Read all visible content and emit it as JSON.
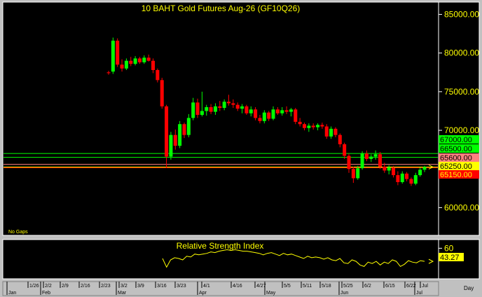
{
  "chart_data": {
    "type": "candlestick",
    "title": "10 BAHT Gold Futures Aug-26 (GF10Q26)",
    "price_axis": {
      "ticks": [
        "85000.00",
        "80000.00",
        "75000.00",
        "70000.00",
        "65000.00",
        "60000.00"
      ],
      "ylim": [
        56500,
        86500
      ]
    },
    "levels": [
      {
        "label": "67000.00",
        "value": 67000,
        "color": "#00ff00",
        "text_color": "#000000"
      },
      {
        "label": "66500.00",
        "value": 66500,
        "color": "#00ff00",
        "text_color": "#000000"
      },
      {
        "label": "65600.00",
        "value": 65600,
        "color": "#ff8080",
        "text_color": "#000000"
      },
      {
        "label": "65250.00",
        "value": 65250,
        "color": "#ffff00",
        "text_color": "#000000"
      },
      {
        "label": "65150.00",
        "value": 65150,
        "color": "#ff0000",
        "text_color": "#ffff00"
      }
    ],
    "date_axis": {
      "month_labels": [
        "Jan",
        "Feb",
        "Mar",
        "Apr",
        "May",
        "Jun",
        "Jul"
      ],
      "day_labels": [
        "1/26",
        "2/2",
        "2/9",
        "2/16",
        "2/23",
        "3/2",
        "3/9",
        "3/16",
        "3/23",
        "4/1",
        "4/16",
        "4/27",
        "5/5",
        "5/11",
        "5/18",
        "5/25",
        "6/2",
        "6/15",
        "6/22",
        "Jul"
      ],
      "unit_label": "Day"
    },
    "notes": "No Gaps",
    "candles": [
      {
        "o": 77500,
        "h": 77700,
        "l": 77200,
        "c": 77400
      },
      {
        "o": 77600,
        "h": 82000,
        "l": 77300,
        "c": 81600
      },
      {
        "o": 81600,
        "h": 81900,
        "l": 78200,
        "c": 78500
      },
      {
        "o": 78500,
        "h": 79200,
        "l": 77600,
        "c": 78000
      },
      {
        "o": 78000,
        "h": 79300,
        "l": 77800,
        "c": 79000
      },
      {
        "o": 79000,
        "h": 79500,
        "l": 78300,
        "c": 78600
      },
      {
        "o": 78600,
        "h": 79600,
        "l": 78400,
        "c": 79300
      },
      {
        "o": 79300,
        "h": 79500,
        "l": 78600,
        "c": 78800
      },
      {
        "o": 78800,
        "h": 79700,
        "l": 78600,
        "c": 79400
      },
      {
        "o": 79400,
        "h": 79800,
        "l": 78900,
        "c": 79000
      },
      {
        "o": 79000,
        "h": 79300,
        "l": 77400,
        "c": 77800
      },
      {
        "o": 77800,
        "h": 78000,
        "l": 76200,
        "c": 76500
      },
      {
        "o": 76500,
        "h": 76800,
        "l": 72800,
        "c": 73100
      },
      {
        "o": 73100,
        "h": 73300,
        "l": 65200,
        "c": 66600
      },
      {
        "o": 66600,
        "h": 69800,
        "l": 66200,
        "c": 69400
      },
      {
        "o": 69400,
        "h": 70100,
        "l": 67500,
        "c": 68000
      },
      {
        "o": 68000,
        "h": 71200,
        "l": 67700,
        "c": 70800
      },
      {
        "o": 70800,
        "h": 71000,
        "l": 69000,
        "c": 69400
      },
      {
        "o": 69400,
        "h": 72100,
        "l": 69100,
        "c": 71600
      },
      {
        "o": 71600,
        "h": 74200,
        "l": 71300,
        "c": 73600
      },
      {
        "o": 73600,
        "h": 74100,
        "l": 71600,
        "c": 72000
      },
      {
        "o": 72000,
        "h": 75000,
        "l": 71800,
        "c": 72500
      },
      {
        "o": 72500,
        "h": 73300,
        "l": 71900,
        "c": 73000
      },
      {
        "o": 73000,
        "h": 73400,
        "l": 72100,
        "c": 72400
      },
      {
        "o": 72400,
        "h": 73500,
        "l": 72000,
        "c": 73100
      },
      {
        "o": 73100,
        "h": 73800,
        "l": 72500,
        "c": 72900
      },
      {
        "o": 72900,
        "h": 74000,
        "l": 72600,
        "c": 73700
      },
      {
        "o": 73700,
        "h": 74600,
        "l": 73200,
        "c": 73500
      },
      {
        "o": 73500,
        "h": 74000,
        "l": 72900,
        "c": 73300
      },
      {
        "o": 73300,
        "h": 73600,
        "l": 72500,
        "c": 72800
      },
      {
        "o": 72800,
        "h": 73400,
        "l": 72200,
        "c": 73100
      },
      {
        "o": 73100,
        "h": 73300,
        "l": 72000,
        "c": 72200
      },
      {
        "o": 72200,
        "h": 73100,
        "l": 71800,
        "c": 72700
      },
      {
        "o": 72700,
        "h": 73000,
        "l": 71300,
        "c": 71600
      },
      {
        "o": 71600,
        "h": 72000,
        "l": 70900,
        "c": 71200
      },
      {
        "o": 71200,
        "h": 72600,
        "l": 70900,
        "c": 72300
      },
      {
        "o": 72300,
        "h": 72500,
        "l": 71200,
        "c": 71500
      },
      {
        "o": 71500,
        "h": 73100,
        "l": 71300,
        "c": 72700
      },
      {
        "o": 72700,
        "h": 73000,
        "l": 72000,
        "c": 72200
      },
      {
        "o": 72200,
        "h": 73000,
        "l": 71900,
        "c": 72600
      },
      {
        "o": 72600,
        "h": 73100,
        "l": 72100,
        "c": 72400
      },
      {
        "o": 72400,
        "h": 72900,
        "l": 71800,
        "c": 72700
      },
      {
        "o": 72700,
        "h": 72900,
        "l": 70800,
        "c": 71100
      },
      {
        "o": 71100,
        "h": 71600,
        "l": 70500,
        "c": 70800
      },
      {
        "o": 70800,
        "h": 71000,
        "l": 70000,
        "c": 70300
      },
      {
        "o": 70300,
        "h": 70900,
        "l": 69800,
        "c": 70600
      },
      {
        "o": 70600,
        "h": 70900,
        "l": 70100,
        "c": 70400
      },
      {
        "o": 70400,
        "h": 70900,
        "l": 70000,
        "c": 70700
      },
      {
        "o": 70700,
        "h": 71000,
        "l": 70200,
        "c": 70500
      },
      {
        "o": 70500,
        "h": 70800,
        "l": 68900,
        "c": 69200
      },
      {
        "o": 69200,
        "h": 70500,
        "l": 68900,
        "c": 70200
      },
      {
        "o": 70200,
        "h": 70400,
        "l": 69100,
        "c": 69400
      },
      {
        "o": 69400,
        "h": 69600,
        "l": 67800,
        "c": 68200
      },
      {
        "o": 68200,
        "h": 68400,
        "l": 66300,
        "c": 66700
      },
      {
        "o": 66700,
        "h": 67000,
        "l": 64500,
        "c": 65000
      },
      {
        "o": 65000,
        "h": 65300,
        "l": 63200,
        "c": 63800
      },
      {
        "o": 63800,
        "h": 65400,
        "l": 63600,
        "c": 65100
      },
      {
        "o": 65100,
        "h": 67300,
        "l": 64900,
        "c": 67000
      },
      {
        "o": 67000,
        "h": 67400,
        "l": 66000,
        "c": 66300
      },
      {
        "o": 66300,
        "h": 66900,
        "l": 65900,
        "c": 66600
      },
      {
        "o": 66600,
        "h": 67400,
        "l": 66200,
        "c": 66900
      },
      {
        "o": 66900,
        "h": 67200,
        "l": 65000,
        "c": 65300
      },
      {
        "o": 65300,
        "h": 65800,
        "l": 64500,
        "c": 64800
      },
      {
        "o": 64800,
        "h": 65500,
        "l": 64300,
        "c": 65200
      },
      {
        "o": 65200,
        "h": 65400,
        "l": 63900,
        "c": 64200
      },
      {
        "o": 64200,
        "h": 64700,
        "l": 62900,
        "c": 63300
      },
      {
        "o": 63300,
        "h": 64700,
        "l": 63100,
        "c": 64400
      },
      {
        "o": 64400,
        "h": 64600,
        "l": 63400,
        "c": 63700
      },
      {
        "o": 63700,
        "h": 63900,
        "l": 62800,
        "c": 63100
      },
      {
        "o": 63100,
        "h": 64500,
        "l": 62900,
        "c": 64200
      },
      {
        "o": 64200,
        "h": 65200,
        "l": 64000,
        "c": 64900
      },
      {
        "o": 64900,
        "h": 65400,
        "l": 64600,
        "c": 65250
      }
    ],
    "rsi": {
      "title": "Relative Strength Index",
      "tick": "60",
      "current_label": "43.27",
      "ylim": [
        0,
        100
      ],
      "values": [
        46,
        34,
        44,
        47,
        46,
        44,
        49,
        48,
        52,
        51,
        52,
        53,
        55,
        54,
        56,
        57,
        58,
        57,
        58,
        57,
        56,
        56,
        55,
        54,
        53,
        51,
        53,
        54,
        52,
        50,
        53,
        51,
        52,
        50,
        48,
        46,
        49,
        47,
        48,
        47,
        45,
        47,
        44,
        43,
        46,
        40,
        39,
        44,
        42,
        37,
        35,
        41,
        39,
        42,
        37,
        41,
        39,
        44,
        42,
        35,
        38,
        43,
        41,
        40,
        43,
        42
      ]
    },
    "colors": {
      "up": "#00ff00",
      "down": "#ff0000",
      "background": "#000000",
      "text": "#ffff00"
    }
  }
}
